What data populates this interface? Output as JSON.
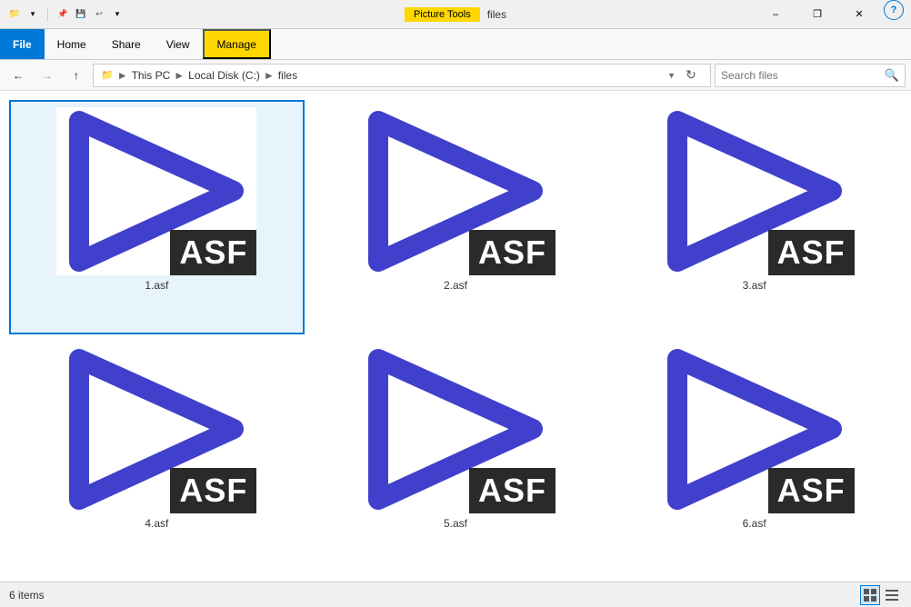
{
  "titleBar": {
    "pictureToolsLabel": "Picture Tools",
    "windowTitle": "files",
    "minLabel": "–",
    "maxLabel": "❐",
    "closeLabel": "✕",
    "quickAccessIcons": [
      "📁",
      "⬇",
      "↩",
      "⬆"
    ]
  },
  "ribbon": {
    "tabs": [
      {
        "id": "file",
        "label": "File",
        "active": false,
        "file": true
      },
      {
        "id": "home",
        "label": "Home",
        "active": false
      },
      {
        "id": "share",
        "label": "Share",
        "active": false
      },
      {
        "id": "view",
        "label": "View",
        "active": false
      },
      {
        "id": "manage",
        "label": "Manage",
        "active": false,
        "manage": true
      }
    ]
  },
  "addressBar": {
    "backDisabled": false,
    "forwardDisabled": true,
    "upLabel": "↑",
    "path": [
      {
        "label": "This PC"
      },
      {
        "label": "Local Disk (C:)"
      },
      {
        "label": "files"
      }
    ],
    "searchPlaceholder": "Search files",
    "refreshLabel": "⟳"
  },
  "files": [
    {
      "id": 1,
      "name": "1.asf",
      "selected": true,
      "badge": "ASF"
    },
    {
      "id": 2,
      "name": "2.asf",
      "selected": false,
      "badge": "ASF"
    },
    {
      "id": 3,
      "name": "3.asf",
      "selected": false,
      "badge": "ASF"
    },
    {
      "id": 4,
      "name": "4.asf",
      "selected": false,
      "badge": "ASF"
    },
    {
      "id": 5,
      "name": "5.asf",
      "selected": false,
      "badge": "ASF"
    },
    {
      "id": 6,
      "name": "6.asf",
      "selected": false,
      "badge": "ASF"
    }
  ],
  "statusBar": {
    "itemCount": "6 items",
    "viewGrid": "⊞",
    "viewList": "☰"
  }
}
